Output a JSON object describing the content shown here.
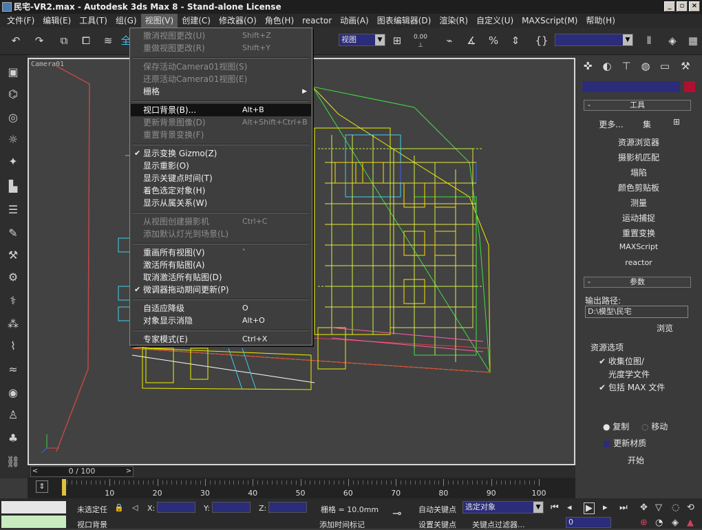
{
  "title": "民宅-VR2.max - Autodesk 3ds Max 8 - Stand-alone License",
  "window_buttons": [
    "_",
    "▫",
    "×"
  ],
  "menubar": [
    "文件(F)",
    "编辑(E)",
    "工具(T)",
    "组(G)",
    "视图(V)",
    "创建(C)",
    "修改器(O)",
    "角色(H)",
    "reactor",
    "动画(A)",
    "图表编辑器(D)",
    "渲染(R)",
    "自定义(U)",
    "MAXScript(M)",
    "帮助(H)"
  ],
  "toolbar": {
    "view_select": "视图",
    "snap_label": "0.00",
    "named_selection": ""
  },
  "viewport_label": "Camera01",
  "view_menu": [
    {
      "label": "撤消视图更改(U)",
      "key": "Shift+Z",
      "disabled": true
    },
    {
      "label": "重做视图更改(R)",
      "key": "Shift+Y",
      "disabled": true
    },
    {
      "sep": true
    },
    {
      "label": "保存活动Camera01视图(S)",
      "disabled": true
    },
    {
      "label": "还原活动Camera01视图(E)",
      "disabled": true
    },
    {
      "label": "栅格",
      "submenu": true
    },
    {
      "sep": true
    },
    {
      "label": "视口背景(B)...",
      "key": "Alt+B",
      "highlight": true
    },
    {
      "label": "更新背景图像(D)",
      "key": "Alt+Shift+Ctrl+B",
      "disabled": true
    },
    {
      "label": "重置背景变换(F)",
      "disabled": true
    },
    {
      "sep": true
    },
    {
      "label": "显示变换 Gizmo(Z)",
      "checked": true
    },
    {
      "label": "显示重影(O)"
    },
    {
      "label": "显示关键点时间(T)"
    },
    {
      "label": "着色选定对象(H)"
    },
    {
      "label": "显示从属关系(W)"
    },
    {
      "sep": true
    },
    {
      "label": "从视图创建摄影机",
      "key": "Ctrl+C",
      "disabled": true
    },
    {
      "label": "添加默认灯光到场景(L)",
      "disabled": true
    },
    {
      "sep": true
    },
    {
      "label": "重画所有视图(V)",
      "key": "`"
    },
    {
      "label": "激活所有贴图(A)"
    },
    {
      "label": "取消激活所有贴图(D)"
    },
    {
      "label": "微调器拖动期间更新(P)",
      "checked": true
    },
    {
      "sep": true
    },
    {
      "label": "自适应降级",
      "key": "O"
    },
    {
      "label": "对象显示消隐",
      "key": "Alt+O"
    },
    {
      "sep": true
    },
    {
      "label": "专家模式(E)",
      "key": "Ctrl+X"
    }
  ],
  "rightpanel": {
    "rollout_tools": "工具",
    "more": "更多...",
    "sets": "集",
    "tools": [
      "资源浏览器",
      "摄影机匹配",
      "塌陷",
      "颜色剪贴板",
      "测量",
      "运动捕捉",
      "重置变换",
      "MAXScript",
      "reactor"
    ],
    "rollout_params": "参数",
    "output_path_label": "输出路径:",
    "output_path_value": "D:\\模型\\民宅",
    "browse": "浏览",
    "resource_options": "资源选项",
    "collect_bitmaps": "收集位图/",
    "photometric": "光度学文件",
    "include_max": "包括 MAX 文件",
    "copy": "复制",
    "move": "移动",
    "update_material": "更新材质",
    "start": "开始"
  },
  "timeline": {
    "slider": "0 / 100",
    "ticks": [
      "10",
      "20",
      "30",
      "40",
      "50",
      "60",
      "70",
      "80",
      "90",
      "100"
    ]
  },
  "status": {
    "selection": "未选定任",
    "x_label": "X:",
    "y_label": "Y:",
    "z_label": "Z:",
    "grid": "栅格 = 10.0mm",
    "autokey": "自动关键点",
    "selected_obj": "选定对象",
    "set_key": "设置关键点",
    "key_filter": "关键点过滤器...",
    "prompt": "视口背景",
    "add_time_tag": "添加时间标记",
    "frame": "0"
  },
  "colors": {
    "accent_blue": "#2b2c7a",
    "highlight": "#121212",
    "wire_yellow": "#f0f000",
    "wire_green": "#40e040",
    "wire_cyan": "#40d0f0"
  }
}
